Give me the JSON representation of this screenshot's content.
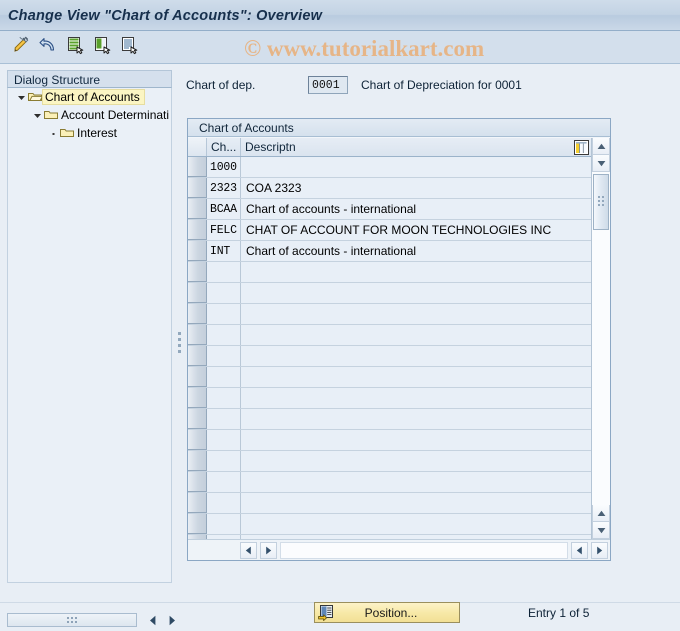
{
  "window": {
    "title": "Change View \"Chart of Accounts\": Overview"
  },
  "watermark": {
    "text": "© www.tutorialkart.com",
    "color": "#e8b382"
  },
  "toolbar": {
    "buttons": [
      {
        "name": "edit-pencil-icon",
        "tooltip": "Change"
      },
      {
        "name": "undo-arrow-icon",
        "tooltip": "Undo"
      },
      {
        "name": "new-entries-icon",
        "tooltip": "New Entries"
      },
      {
        "name": "copy-as-icon",
        "tooltip": "Copy As"
      },
      {
        "name": "details-icon",
        "tooltip": "Details"
      }
    ]
  },
  "sidebar": {
    "header": "Dialog Structure",
    "items": [
      {
        "label": "Chart of Accounts",
        "level": 0,
        "expanded": true,
        "selected": true,
        "twisty": "down"
      },
      {
        "label": "Account Determinati",
        "level": 1,
        "expanded": true,
        "selected": false,
        "twisty": "down"
      },
      {
        "label": "Interest",
        "level": 2,
        "expanded": false,
        "selected": false,
        "twisty": "dot"
      }
    ]
  },
  "header_fields": {
    "chart_of_dep_label": "Chart of dep.",
    "chart_of_dep_value": "0001",
    "chart_of_dep_description": "Chart of Depreciation for 0001"
  },
  "table": {
    "title": "Chart of Accounts",
    "columns": [
      "Ch...",
      "Descriptn"
    ],
    "config_icon": "column-settings-icon",
    "rows": [
      {
        "key": "1000",
        "description": ""
      },
      {
        "key": "2323",
        "description": "COA 2323"
      },
      {
        "key": "BCAA",
        "description": "Chart of accounts - international"
      },
      {
        "key": "FELC",
        "description": "CHAT OF ACCOUNT FOR MOON TECHNOLOGIES INC"
      },
      {
        "key": "INT",
        "description": "Chart of accounts - international"
      }
    ],
    "empty_row_count": 17
  },
  "footer": {
    "position_button": "Position...",
    "entry_status": "Entry 1 of 5"
  }
}
